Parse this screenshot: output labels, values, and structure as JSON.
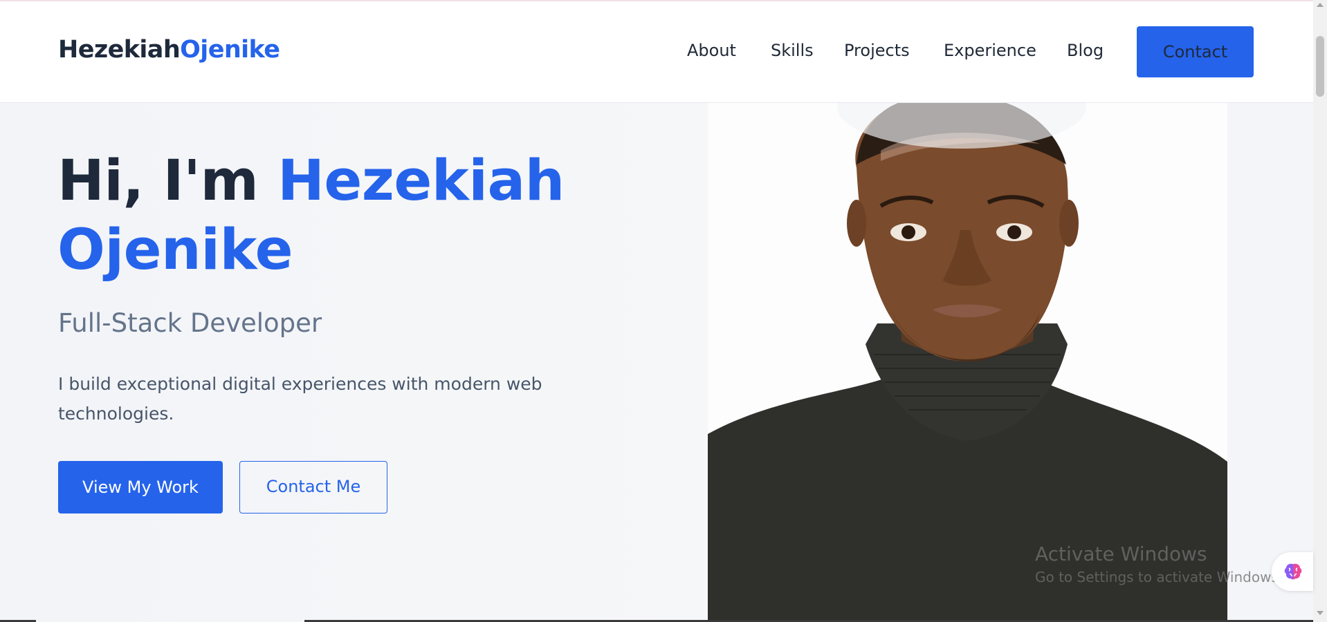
{
  "header": {
    "logo_part1": "Hezekiah",
    "logo_part2": "Ojenike",
    "nav": [
      {
        "label": "About"
      },
      {
        "label": "Skills"
      },
      {
        "label": "Projects"
      },
      {
        "label": "Experience"
      },
      {
        "label": "Blog"
      }
    ],
    "contact_label": "Contact"
  },
  "hero": {
    "greeting": "Hi, I'm ",
    "name": "Hezekiah Ojenike",
    "role": "Full-Stack Developer",
    "description": "I build exceptional digital experiences with modern web technologies.",
    "primary_button": "View My Work",
    "secondary_button": "Contact Me",
    "photo_icon": "profile-photo"
  },
  "overlay": {
    "activate_title": "Activate Windows",
    "activate_sub": "Go to Settings to activate Windows.",
    "extension_icon": "brain-icon"
  },
  "colors": {
    "accent": "#2563eb",
    "text_dark": "#1e293b",
    "text_muted": "#64748b",
    "background": "#f3f5f8"
  }
}
